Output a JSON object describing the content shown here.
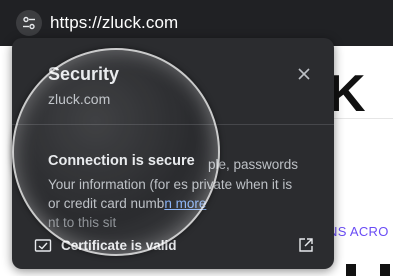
{
  "browser": {
    "url": "https://zluck.com",
    "site_info_icon": "tune-icon"
  },
  "page": {
    "logo_partial": "K",
    "caption_partial": "NS ACRO"
  },
  "popup": {
    "title": "Security",
    "subtitle": "zluck.com",
    "close_icon": "close-icon",
    "connection": {
      "title": "Connection is secure",
      "line1": "ple, passwords",
      "line2_prefix": "Your information (for e",
      "line2_suffix": "s private when it is",
      "line3_prefix": "or credit card numb",
      "learn_more": "n more",
      "line4": "nt to this sit"
    },
    "certificate": {
      "label": "Certificate is valid",
      "icon": "certificate-icon",
      "open_icon": "open-external-icon"
    }
  },
  "colors": {
    "popup_bg": "#2b2c2f",
    "link": "#8ab4f8",
    "accent_caption": "#6a4cf5"
  }
}
